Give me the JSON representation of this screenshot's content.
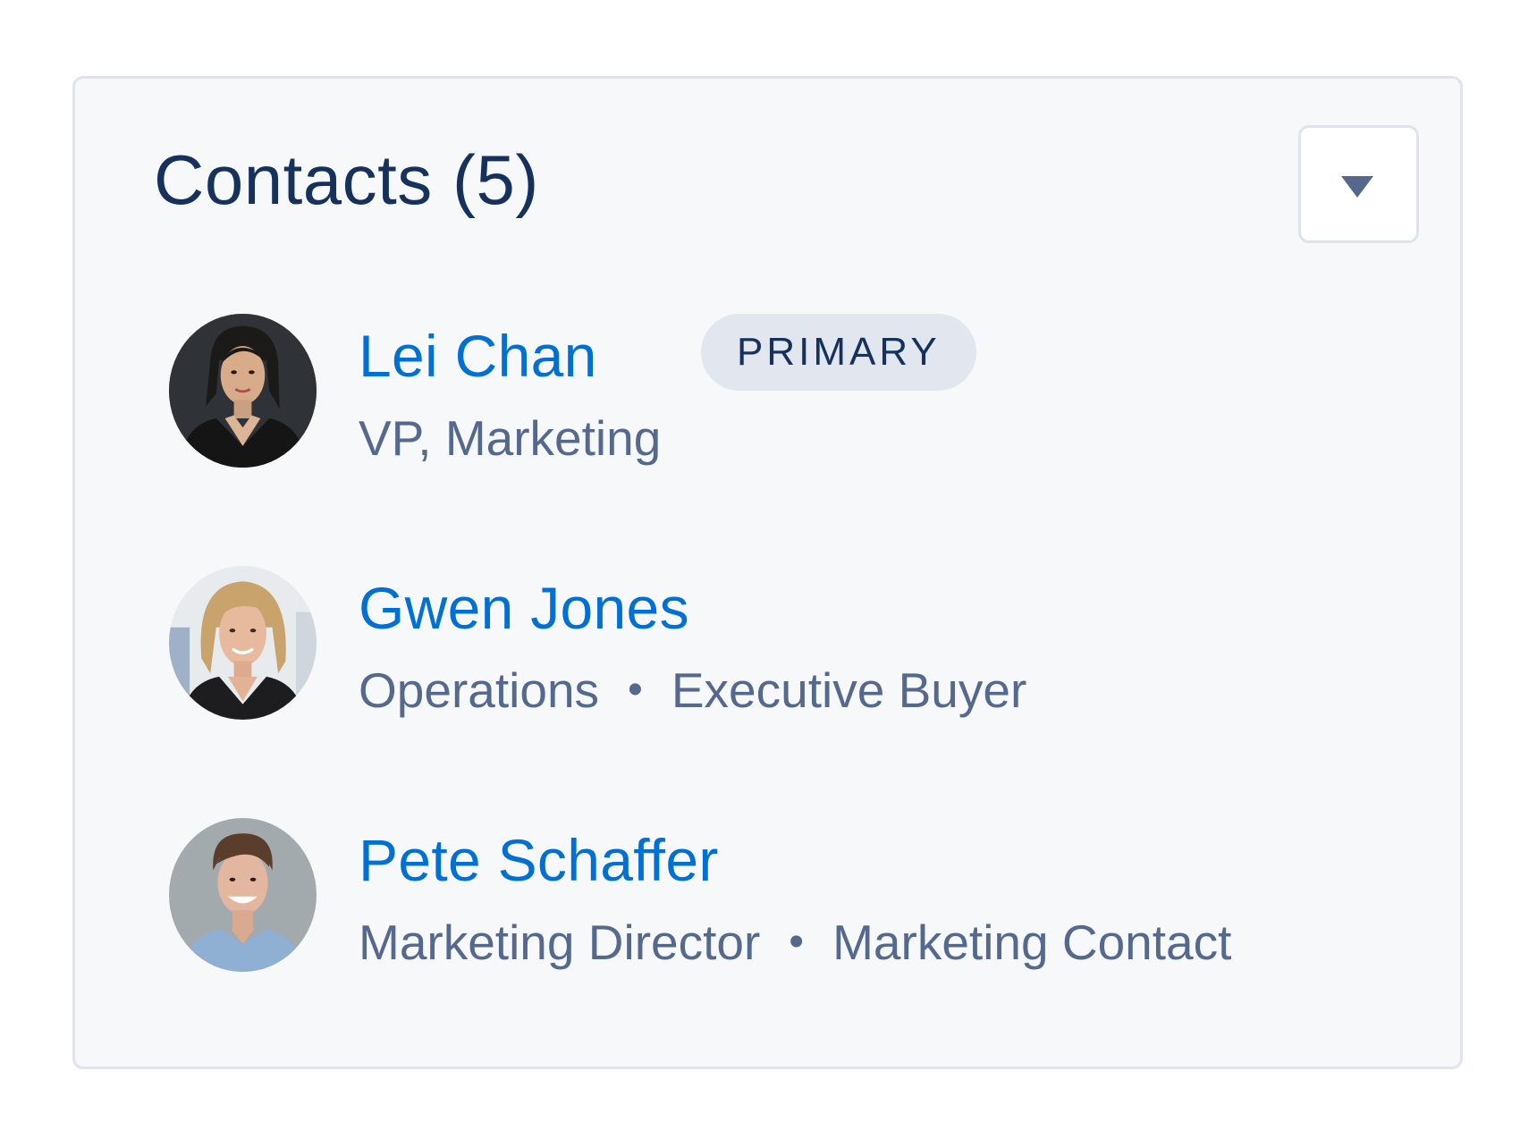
{
  "card": {
    "title": "Contacts (5)",
    "menu_icon": "chevron-down-icon"
  },
  "contacts": [
    {
      "name": "Lei Chan",
      "badge": "PRIMARY",
      "title": "VP, Marketing",
      "avatar_icon": "avatar-photo-lei-chan"
    },
    {
      "name": "Gwen Jones",
      "department": "Operations",
      "role": "Executive Buyer",
      "avatar_icon": "avatar-photo-gwen-jones"
    },
    {
      "name": "Pete Schaffer",
      "department": "Marketing Director",
      "role": "Marketing Contact",
      "avatar_icon": "avatar-photo-pete-schaffer"
    }
  ],
  "colors": {
    "link": "#0070d2",
    "heading": "#16325c",
    "secondary_text": "#54698d",
    "card_background": "#f7f8fa",
    "border": "#dfe3ec",
    "badge_background": "#e1e6ef"
  }
}
